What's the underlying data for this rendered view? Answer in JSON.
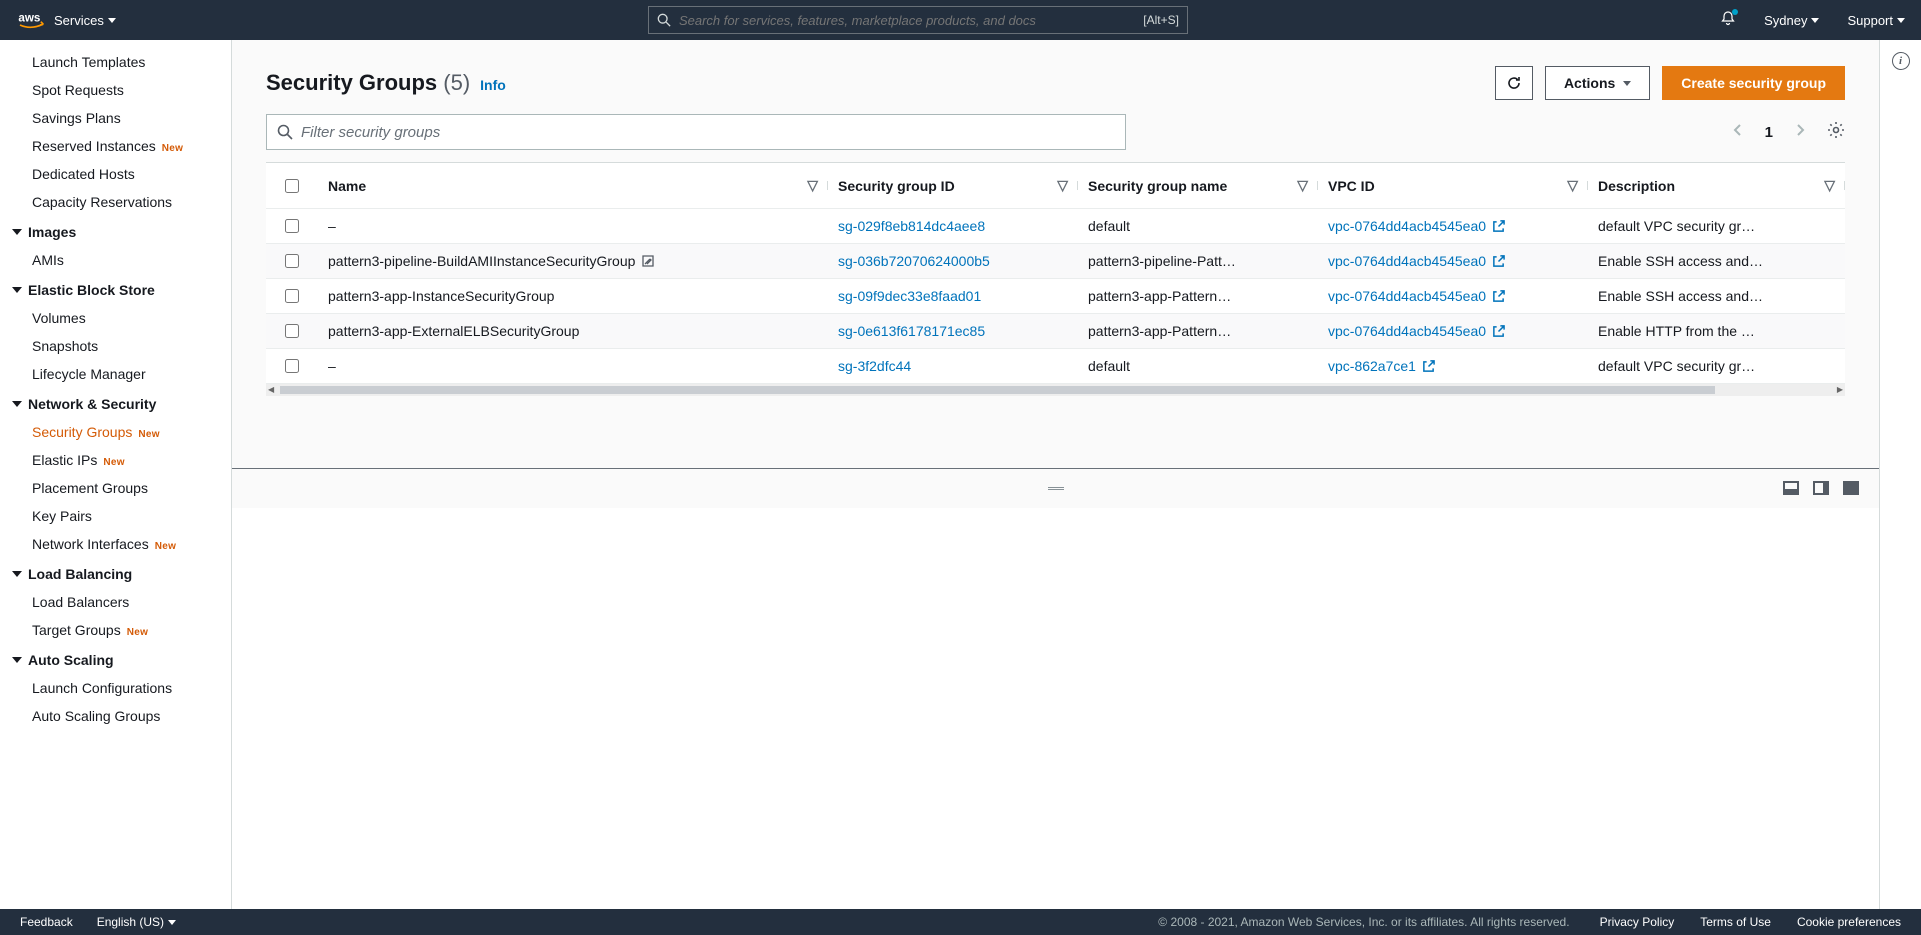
{
  "topnav": {
    "services_label": "Services",
    "search_placeholder": "Search for services, features, marketplace products, and docs",
    "search_shortcut": "[Alt+S]",
    "region": "Sydney",
    "support": "Support"
  },
  "sidebar": [
    {
      "type": "item",
      "label": "Launch Templates"
    },
    {
      "type": "item",
      "label": "Spot Requests"
    },
    {
      "type": "item",
      "label": "Savings Plans"
    },
    {
      "type": "item",
      "label": "Reserved Instances",
      "badge": "New"
    },
    {
      "type": "item",
      "label": "Dedicated Hosts"
    },
    {
      "type": "item",
      "label": "Capacity Reservations"
    },
    {
      "type": "header",
      "label": "Images"
    },
    {
      "type": "item",
      "label": "AMIs"
    },
    {
      "type": "header",
      "label": "Elastic Block Store"
    },
    {
      "type": "item",
      "label": "Volumes"
    },
    {
      "type": "item",
      "label": "Snapshots"
    },
    {
      "type": "item",
      "label": "Lifecycle Manager"
    },
    {
      "type": "header",
      "label": "Network & Security"
    },
    {
      "type": "item",
      "label": "Security Groups",
      "badge": "New",
      "active": true
    },
    {
      "type": "item",
      "label": "Elastic IPs",
      "badge": "New"
    },
    {
      "type": "item",
      "label": "Placement Groups"
    },
    {
      "type": "item",
      "label": "Key Pairs"
    },
    {
      "type": "item",
      "label": "Network Interfaces",
      "badge": "New"
    },
    {
      "type": "header",
      "label": "Load Balancing"
    },
    {
      "type": "item",
      "label": "Load Balancers"
    },
    {
      "type": "item",
      "label": "Target Groups",
      "badge": "New"
    },
    {
      "type": "header",
      "label": "Auto Scaling"
    },
    {
      "type": "item",
      "label": "Launch Configurations"
    },
    {
      "type": "item",
      "label": "Auto Scaling Groups"
    }
  ],
  "page": {
    "title": "Security Groups",
    "count": "(5)",
    "info": "Info",
    "actions_label": "Actions",
    "create_label": "Create security group",
    "filter_placeholder": "Filter security groups",
    "page_number": "1"
  },
  "columns": {
    "name": "Name",
    "sgid": "Security group ID",
    "sgname": "Security group name",
    "vpc": "VPC ID",
    "desc": "Description"
  },
  "rows": [
    {
      "name": "–",
      "editable": false,
      "sgid": "sg-029f8eb814dc4aee8",
      "sgname": "default",
      "vpc": "vpc-0764dd4acb4545ea0",
      "desc": "default VPC security gr…"
    },
    {
      "name": "pattern3-pipeline-BuildAMIInstanceSecurityGroup",
      "editable": true,
      "sgid": "sg-036b72070624000b5",
      "sgname": "pattern3-pipeline-Patt…",
      "vpc": "vpc-0764dd4acb4545ea0",
      "desc": "Enable SSH access and…"
    },
    {
      "name": "pattern3-app-InstanceSecurityGroup",
      "editable": false,
      "sgid": "sg-09f9dec33e8faad01",
      "sgname": "pattern3-app-Pattern…",
      "vpc": "vpc-0764dd4acb4545ea0",
      "desc": "Enable SSH access and…"
    },
    {
      "name": "pattern3-app-ExternalELBSecurityGroup",
      "editable": false,
      "sgid": "sg-0e613f6178171ec85",
      "sgname": "pattern3-app-Pattern…",
      "vpc": "vpc-0764dd4acb4545ea0",
      "desc": "Enable HTTP from the …"
    },
    {
      "name": "–",
      "editable": false,
      "sgid": "sg-3f2dfc44",
      "sgname": "default",
      "vpc": "vpc-862a7ce1",
      "desc": "default VPC security gr…"
    }
  ],
  "footer": {
    "feedback": "Feedback",
    "language": "English (US)",
    "copyright": "© 2008 - 2021, Amazon Web Services, Inc. or its affiliates. All rights reserved.",
    "privacy": "Privacy Policy",
    "terms": "Terms of Use",
    "cookie": "Cookie preferences"
  }
}
